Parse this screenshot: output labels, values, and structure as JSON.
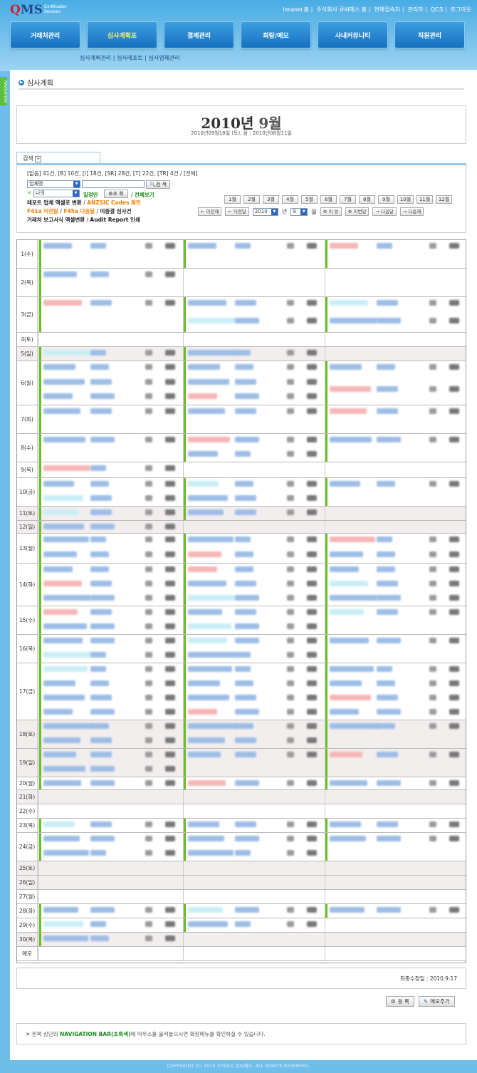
{
  "header": {
    "logo_q": "Q",
    "logo_ms": "MS",
    "logo_sub1": "Certification",
    "logo_sub2": "Services",
    "toplinks": [
      "Intranet 홈",
      "주식회사 큐씨에스 홈",
      "현재접속자",
      "관리자",
      "QCS",
      "로그아웃"
    ],
    "nav": [
      "거래처관리",
      "심사계획표",
      "결제관리",
      "회람/메모",
      "사내커뮤니티",
      "직원관리"
    ],
    "subnav": "심사계획관리 | 심사레포트 | 심사업체관리"
  },
  "sidetab": "NAVIGATION",
  "page": {
    "title": "심사계획",
    "month_year": "2010년",
    "month": "9월",
    "dates": "2010년09월18일 (토), 음 : 2010년08월11일"
  },
  "search": {
    "tab": "검색",
    "tab_icon": "plus-icon",
    "counts": "[없음] 41건, [B] 10건, [I] 18건, [SR] 28건, [T] 22건, [TR] 4건 / [전체]",
    "field_select": "업체명",
    "search_btn": "검 색",
    "owner_select": "나의",
    "schedule_only": "일정만",
    "lookup_btn": "조 회",
    "show_all": "전체보기",
    "link1a": "레포트 업체 엑셀로 변환",
    "link1b": "ANZSIC Codes 확인",
    "link2a": "F41a 이전달",
    "link2b": "F45a 다음달",
    "link2c": "미종결 심사건",
    "link3a": "거래처 보고서식 엑셀변환",
    "link3b": "Audit Report 인쇄",
    "months": [
      "1월",
      "2월",
      "3월",
      "4월",
      "5월",
      "6월",
      "7월",
      "8월",
      "9월",
      "10월",
      "11월",
      "12월"
    ],
    "prev_year": "← 이전해",
    "prev_month": "← 이전달",
    "year_sel": "2010",
    "year_lbl": "년",
    "month_sel": "9",
    "month_lbl": "월",
    "move_btn": "이 동",
    "this_month": "이번달",
    "next_month": "→ 다음달",
    "next_year": "→ 다음해"
  },
  "calendar": {
    "days": [
      "1(수)",
      "2(목)",
      "3(금)",
      "4(토)",
      "5(일)",
      "6(월)",
      "7(화)",
      "8(수)",
      "9(목)",
      "10(금)",
      "11(토)",
      "12(일)",
      "13(월)",
      "14(화)",
      "15(수)",
      "16(목)",
      "17(금)",
      "18(토)",
      "19(일)",
      "20(월)",
      "21(화)",
      "22(수)",
      "23(목)",
      "24(금)",
      "25(토)",
      "26(일)",
      "27(월)",
      "28(화)",
      "29(수)",
      "30(목)",
      "메모"
    ]
  },
  "footer_box": {
    "updated": "최종수정일 : 2010.9.17",
    "register": "등 록",
    "add_memo": "메모추가"
  },
  "note": {
    "pre": "왼쪽 상단의 ",
    "key": "NAVIGATION BAR(초록색)",
    "post": "에 마우스를 올려놓으시면 확장메뉴를 확인하실 수 있습니다."
  },
  "copyright": "COPYRIGHT (C) 2010 주식회사 큐씨에스. ALL RIGHTS RESERVED.",
  "colors": {
    "header": "#49ace4",
    "nav_button": "#1671c0",
    "active_nav": "#fff36a",
    "green_bar": "#6cbf22",
    "pink_entry": "#f6b6b6",
    "weekend_row": "#f3eeee"
  }
}
